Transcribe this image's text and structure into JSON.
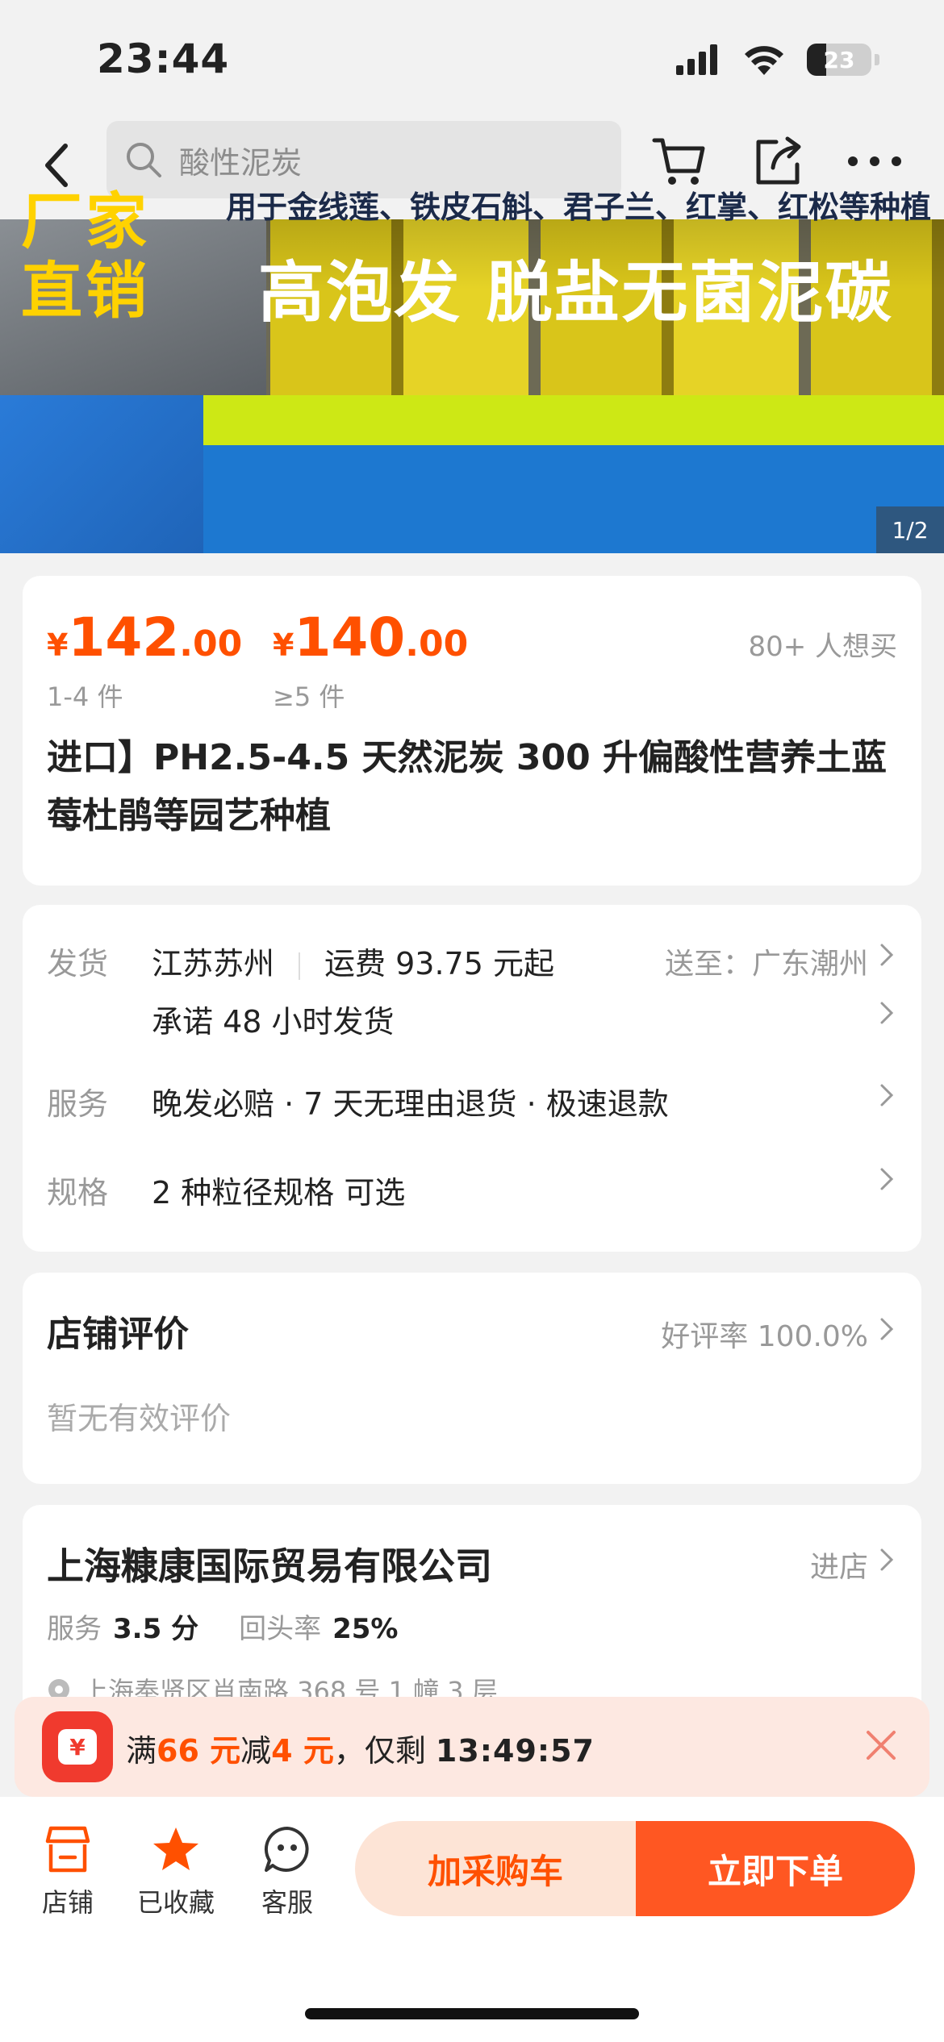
{
  "status": {
    "time": "23:44",
    "battery": "23"
  },
  "nav": {
    "search_placeholder": "酸性泥炭"
  },
  "banner": {
    "badge": "厂家直销",
    "subline": "用于金线莲、铁皮石斛、君子兰、红掌、红松等种植",
    "headline": "高泡发 脱盐无菌泥碳",
    "counter": "1/2"
  },
  "prices": [
    {
      "currency": "¥",
      "int": "142",
      "dec": ".00",
      "qty": "1-4 件"
    },
    {
      "currency": "¥",
      "int": "140",
      "dec": ".00",
      "qty": "≥5 件"
    }
  ],
  "want_count": "80+ 人想买",
  "title": "进口】PH2.5-4.5 天然泥炭 300 升偏酸性营养土蓝莓杜鹃等园艺种植",
  "shipping": {
    "label": "发货",
    "origin": "江苏苏州",
    "fee": "运费 93.75 元起",
    "dest": "送至：广东潮州",
    "promise": "承诺 48 小时发货"
  },
  "service": {
    "label": "服务",
    "value": "晚发必赔 · 7 天无理由退货 · 极速退款"
  },
  "spec": {
    "label": "规格",
    "value": "2 种粒径规格 可选"
  },
  "review": {
    "title": "店铺评价",
    "rate": "好评率 100.0%",
    "empty": "暂无有效评价"
  },
  "shop": {
    "name": "上海糠康国际贸易有限公司",
    "enter": "进店",
    "service_label": "服务",
    "service_score": "3.5 分",
    "repeat_label": "回头率",
    "repeat_rate": "25%",
    "address": "上海奉贤区肖南路 368 号 1 幢 3 层"
  },
  "promo": {
    "prefix": "满",
    "threshold": "66 元",
    "mid": "减",
    "discount": "4 元",
    "suffix": "，仅剩 ",
    "timer": "13:49:57"
  },
  "tabs": {
    "shop": "店铺",
    "fav": "已收藏",
    "service": "客服"
  },
  "actions": {
    "cart": "加采购车",
    "buy": "立即下单"
  },
  "colors": {
    "accent": "#ff5000",
    "buy": "#ff5722",
    "cart_bg": "#fde4d6",
    "promo_bg": "#fde8e1"
  }
}
